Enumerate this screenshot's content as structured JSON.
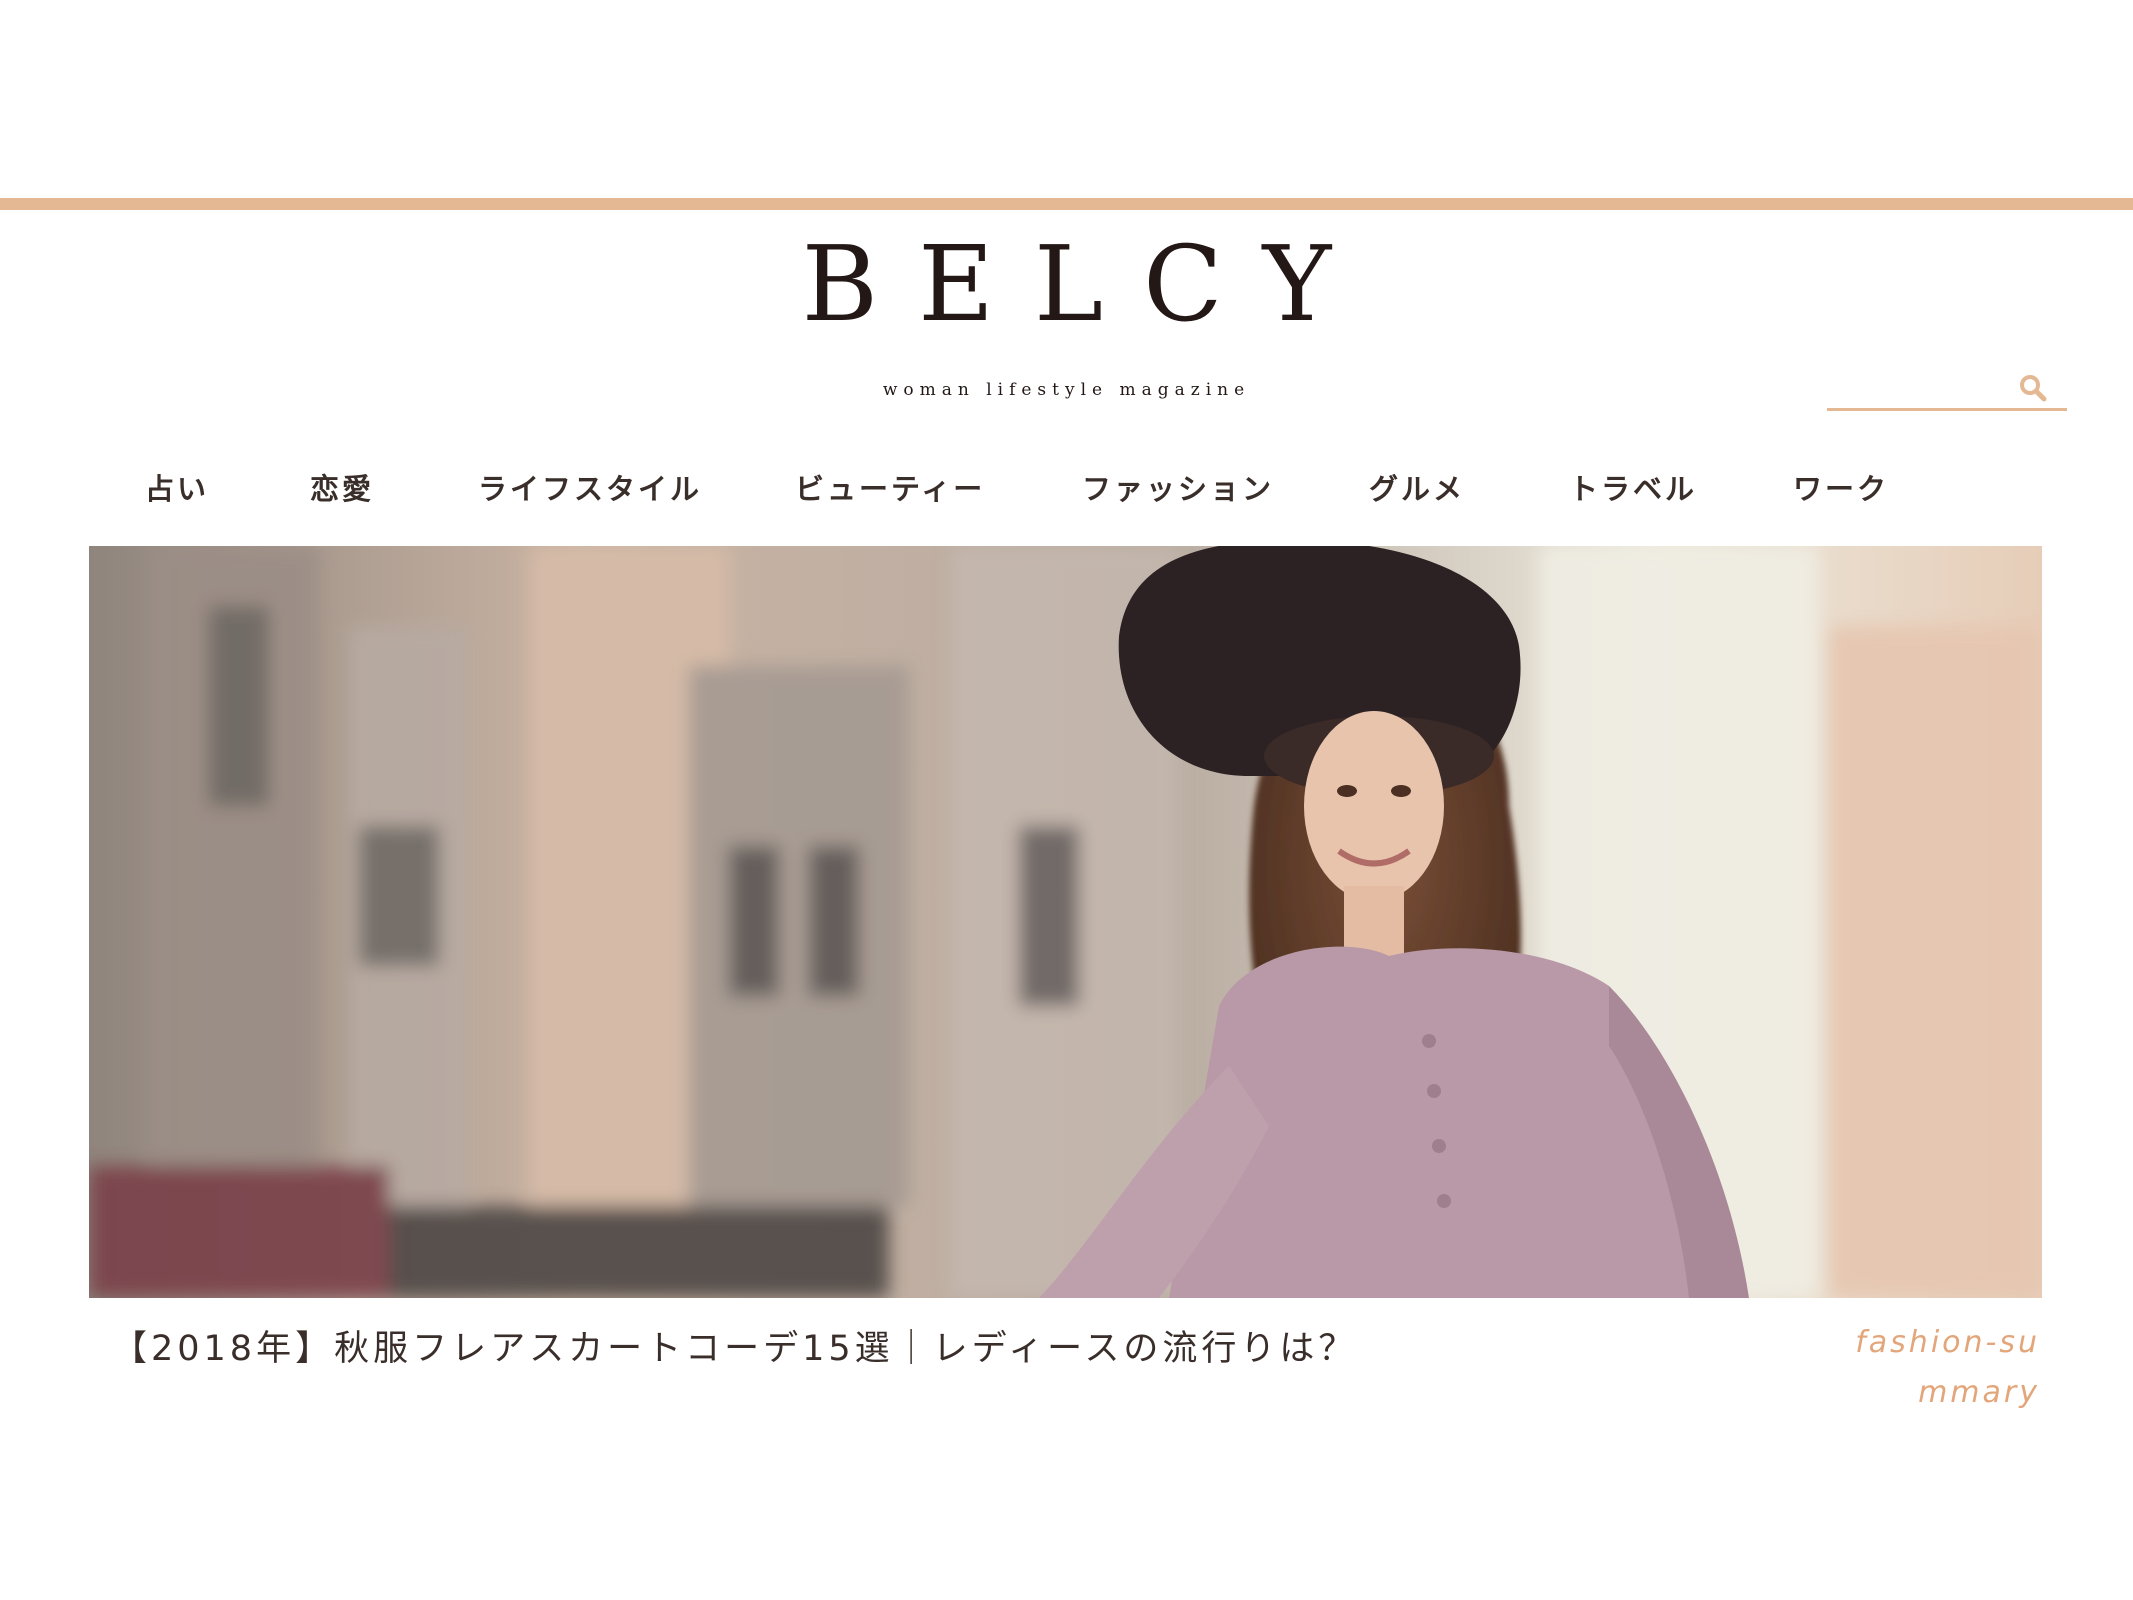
{
  "brand": {
    "logo": "BELCY",
    "tagline": "woman lifestyle magazine",
    "accent_color": "#e5b894"
  },
  "search": {
    "placeholder": "",
    "icon": "search-icon"
  },
  "nav": {
    "items": [
      {
        "label": "占い"
      },
      {
        "label": "恋愛"
      },
      {
        "label": "ライフスタイル"
      },
      {
        "label": "ビューティー"
      },
      {
        "label": "ファッション"
      },
      {
        "label": "グルメ"
      },
      {
        "label": "トラベル"
      },
      {
        "label": "ワーク"
      }
    ]
  },
  "featured": {
    "image_alt": "smiling woman in black hat and pink blouse on a city street",
    "title": "【2018年】秋服フレアスカートコーデ15選｜レディースの流行りは？",
    "category": "fashion-summary",
    "category_color": "#e3a57a"
  }
}
